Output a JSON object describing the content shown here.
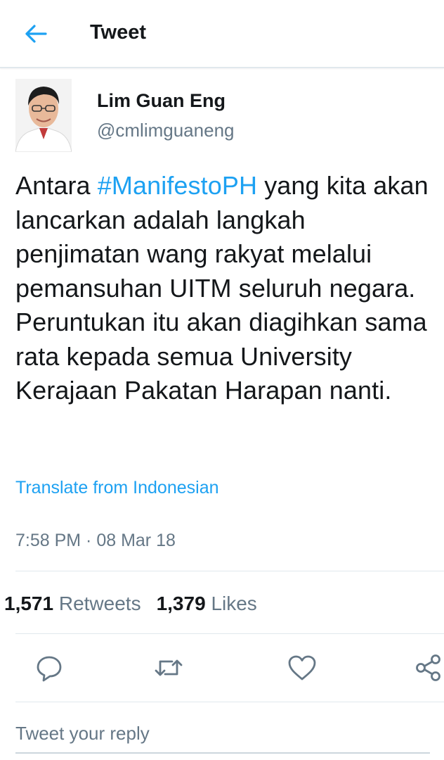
{
  "header": {
    "title": "Tweet",
    "back_icon": "arrow-left-icon",
    "accent": "#1da1f2"
  },
  "author": {
    "name": "Lim Guan Eng",
    "handle": "@cmlimguaneng"
  },
  "tweet": {
    "text_before": "Antara ",
    "hashtag": "#ManifestoPH",
    "text_after": " yang kita akan lancarkan adalah langkah penjimatan wang rakyat melalui pemansuhan UITM seluruh negara. Peruntukan itu akan diagihkan sama rata kepada semua University Kerajaan Pakatan Harapan nanti.",
    "translate_label": "Translate from Indonesian",
    "timestamp": "7:58 PM · 08 Mar 18"
  },
  "stats": {
    "retweets_count": "1,571",
    "retweets_label": "Retweets",
    "likes_count": "1,379",
    "likes_label": "Likes"
  },
  "actions": {
    "reply_icon": "reply-icon",
    "retweet_icon": "retweet-icon",
    "like_icon": "heart-icon",
    "share_icon": "share-icon",
    "icon_color": "#657786"
  },
  "reply": {
    "placeholder": "Tweet your reply"
  }
}
